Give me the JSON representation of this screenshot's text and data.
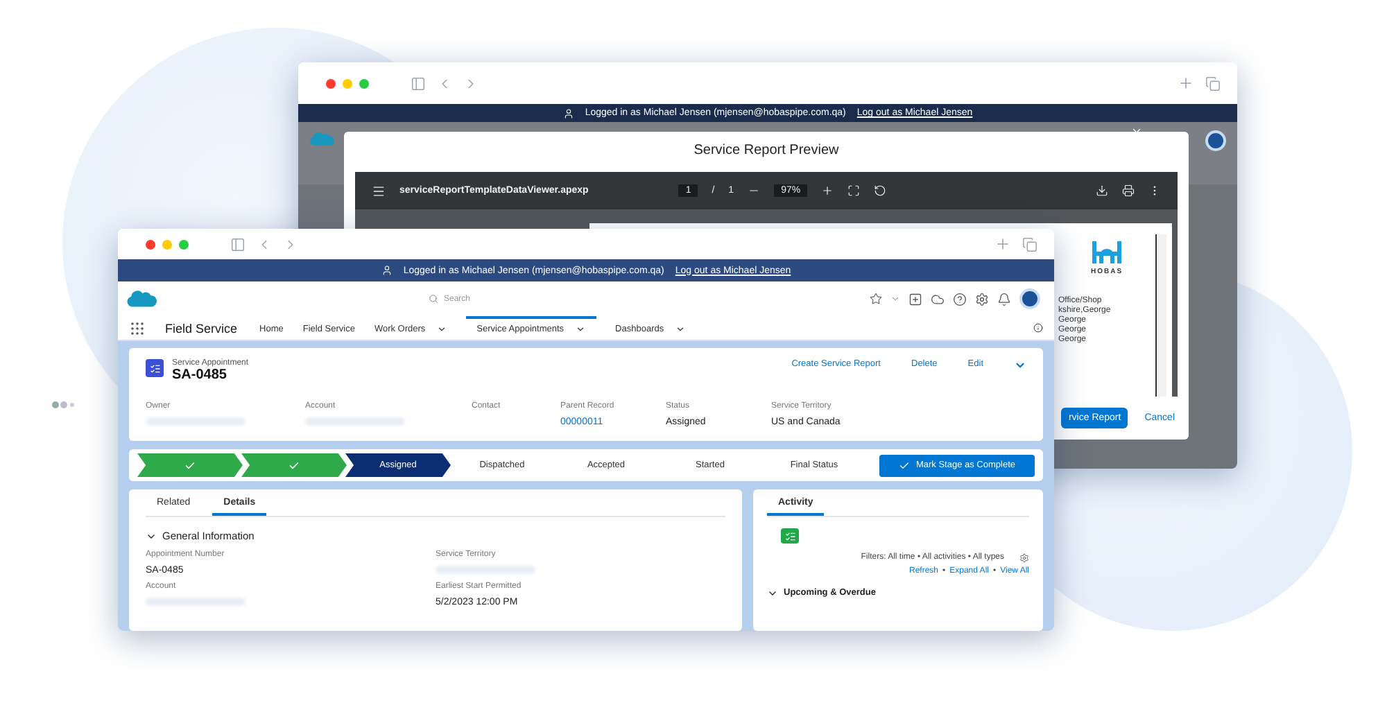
{
  "back_window": {
    "login_banner": {
      "text": "Logged in as Michael Jensen (mjensen@hobaspipe.com.qa)",
      "logout": "Log out as Michael Jensen"
    },
    "dialog": {
      "title": "Service Report Preview",
      "viewer": {
        "file": "serviceReportTemplateDataViewer.apexp",
        "page": "1",
        "separator": "/",
        "pages": "1",
        "zoom": "97%"
      },
      "logo": "HOBAS",
      "document_lines": [
        "Office/Shop",
        "kshire,George",
        "George",
        "George",
        "George"
      ],
      "buttons": [
        {
          "label": "rvice Report",
          "kind": "primary"
        },
        {
          "label": "Cancel",
          "kind": "link"
        }
      ]
    }
  },
  "front_window": {
    "login_banner": {
      "text": "Logged in as Michael Jensen (mjensen@hobaspipe.com.qa)",
      "logout": "Log out as Michael Jensen"
    },
    "search": {
      "placeholder": "Search"
    },
    "app_name": "Field Service",
    "nav": [
      {
        "label": "Home",
        "dropdown": false,
        "selected": false
      },
      {
        "label": "Field Service",
        "dropdown": false,
        "selected": false
      },
      {
        "label": "Work Orders",
        "dropdown": true,
        "selected": false
      },
      {
        "label": "Service Appointments",
        "dropdown": true,
        "selected": true
      },
      {
        "label": "Dashboards",
        "dropdown": true,
        "selected": false
      }
    ],
    "record": {
      "object_type": "Service Appointment",
      "name": "SA-0485",
      "actions": [
        "Create Service Report",
        "Delete",
        "Edit"
      ],
      "fields": [
        {
          "label": "Owner",
          "kind": "blurred"
        },
        {
          "label": "Account",
          "kind": "blurred"
        },
        {
          "label": "Contact",
          "kind": "empty"
        },
        {
          "label": "Parent Record",
          "value": "00000011",
          "kind": "link"
        },
        {
          "label": "Status",
          "value": "Assigned",
          "kind": "text"
        },
        {
          "label": "Service Territory",
          "value": "US and Canada",
          "kind": "text"
        }
      ]
    },
    "path": {
      "stages": [
        {
          "complete": true,
          "current": false
        },
        {
          "complete": true,
          "current": false
        },
        {
          "label": "Assigned",
          "complete": false,
          "current": true
        },
        {
          "label": "Dispatched",
          "complete": false,
          "current": false
        },
        {
          "label": "Accepted",
          "complete": false,
          "current": false
        },
        {
          "label": "Started",
          "complete": false,
          "current": false
        },
        {
          "label": "Final Status",
          "complete": false,
          "current": false
        }
      ],
      "button": "Mark Stage as Complete"
    },
    "details": {
      "tabs": [
        {
          "label": "Related",
          "selected": false
        },
        {
          "label": "Details",
          "selected": true
        }
      ],
      "section": {
        "title": "General Information",
        "expanded": true
      },
      "fields": [
        {
          "label": "Appointment Number",
          "value": "SA-0485",
          "kind": "text"
        },
        {
          "label": "Service Territory",
          "kind": "blurred"
        },
        {
          "label": "Account",
          "kind": "blurred"
        },
        {
          "label": "Earliest Start Permitted",
          "value": "5/2/2023 12:00 PM",
          "kind": "text"
        }
      ]
    },
    "activity": {
      "tab": {
        "label": "Activity",
        "selected": true
      },
      "filters": "Filters: All time • All activities • All types",
      "links": [
        "Refresh",
        "Expand All",
        "View All"
      ],
      "separator": "•",
      "section": {
        "title": "Upcoming & Overdue",
        "expanded": true
      }
    }
  }
}
